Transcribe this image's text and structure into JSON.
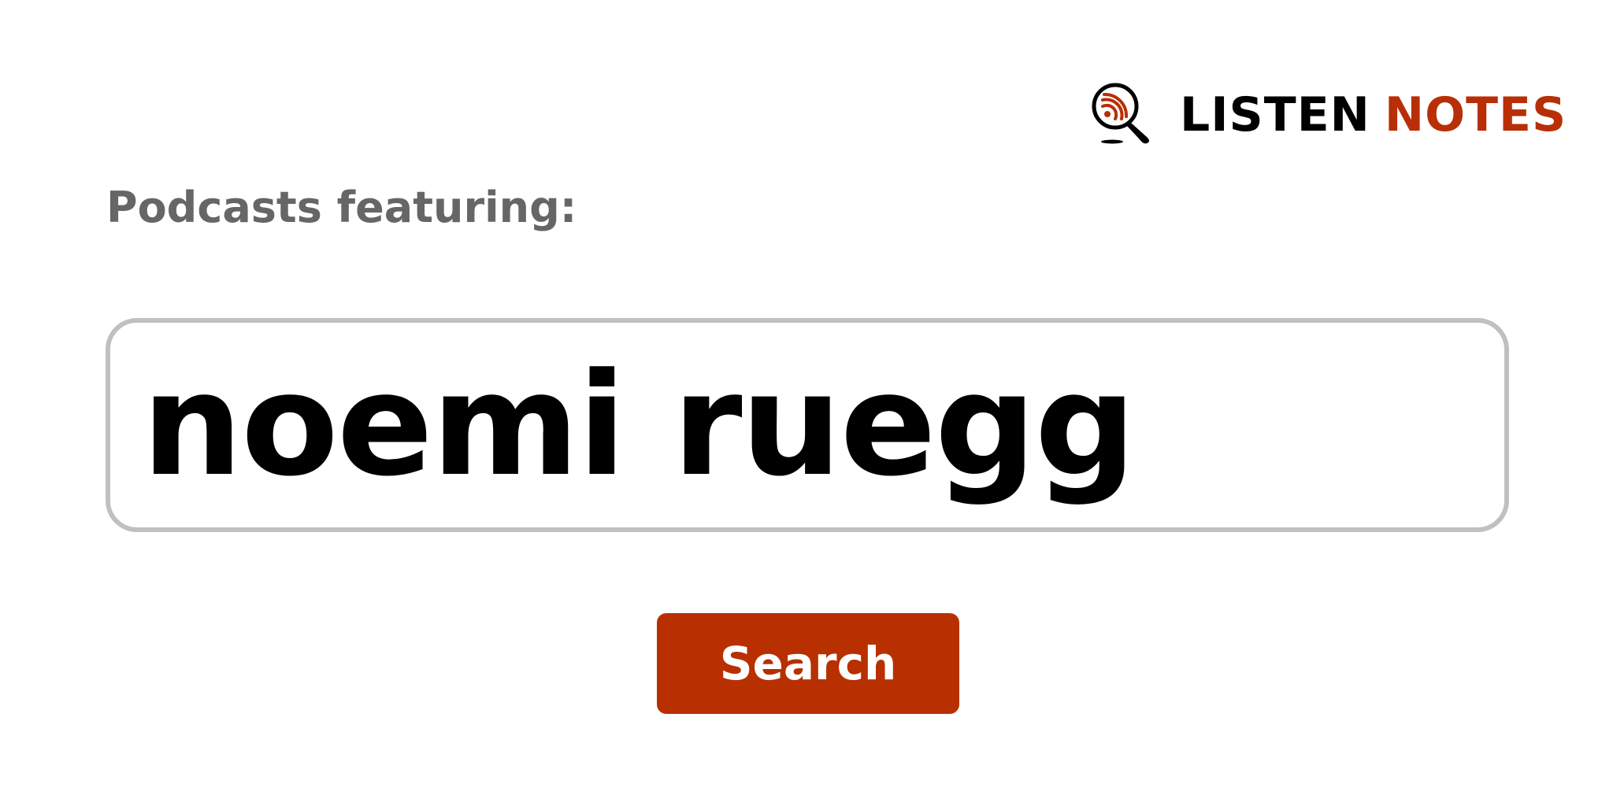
{
  "logo": {
    "word1": "LISTEN",
    "word2": "NOTES",
    "icon": "magnifier-podcast-icon",
    "colors": {
      "primary": "#000000",
      "accent": "#b82f07"
    }
  },
  "label": "Podcasts featuring:",
  "search": {
    "value": "noemi ruegg"
  },
  "button": {
    "label": "Search",
    "color": "#b82f00"
  }
}
